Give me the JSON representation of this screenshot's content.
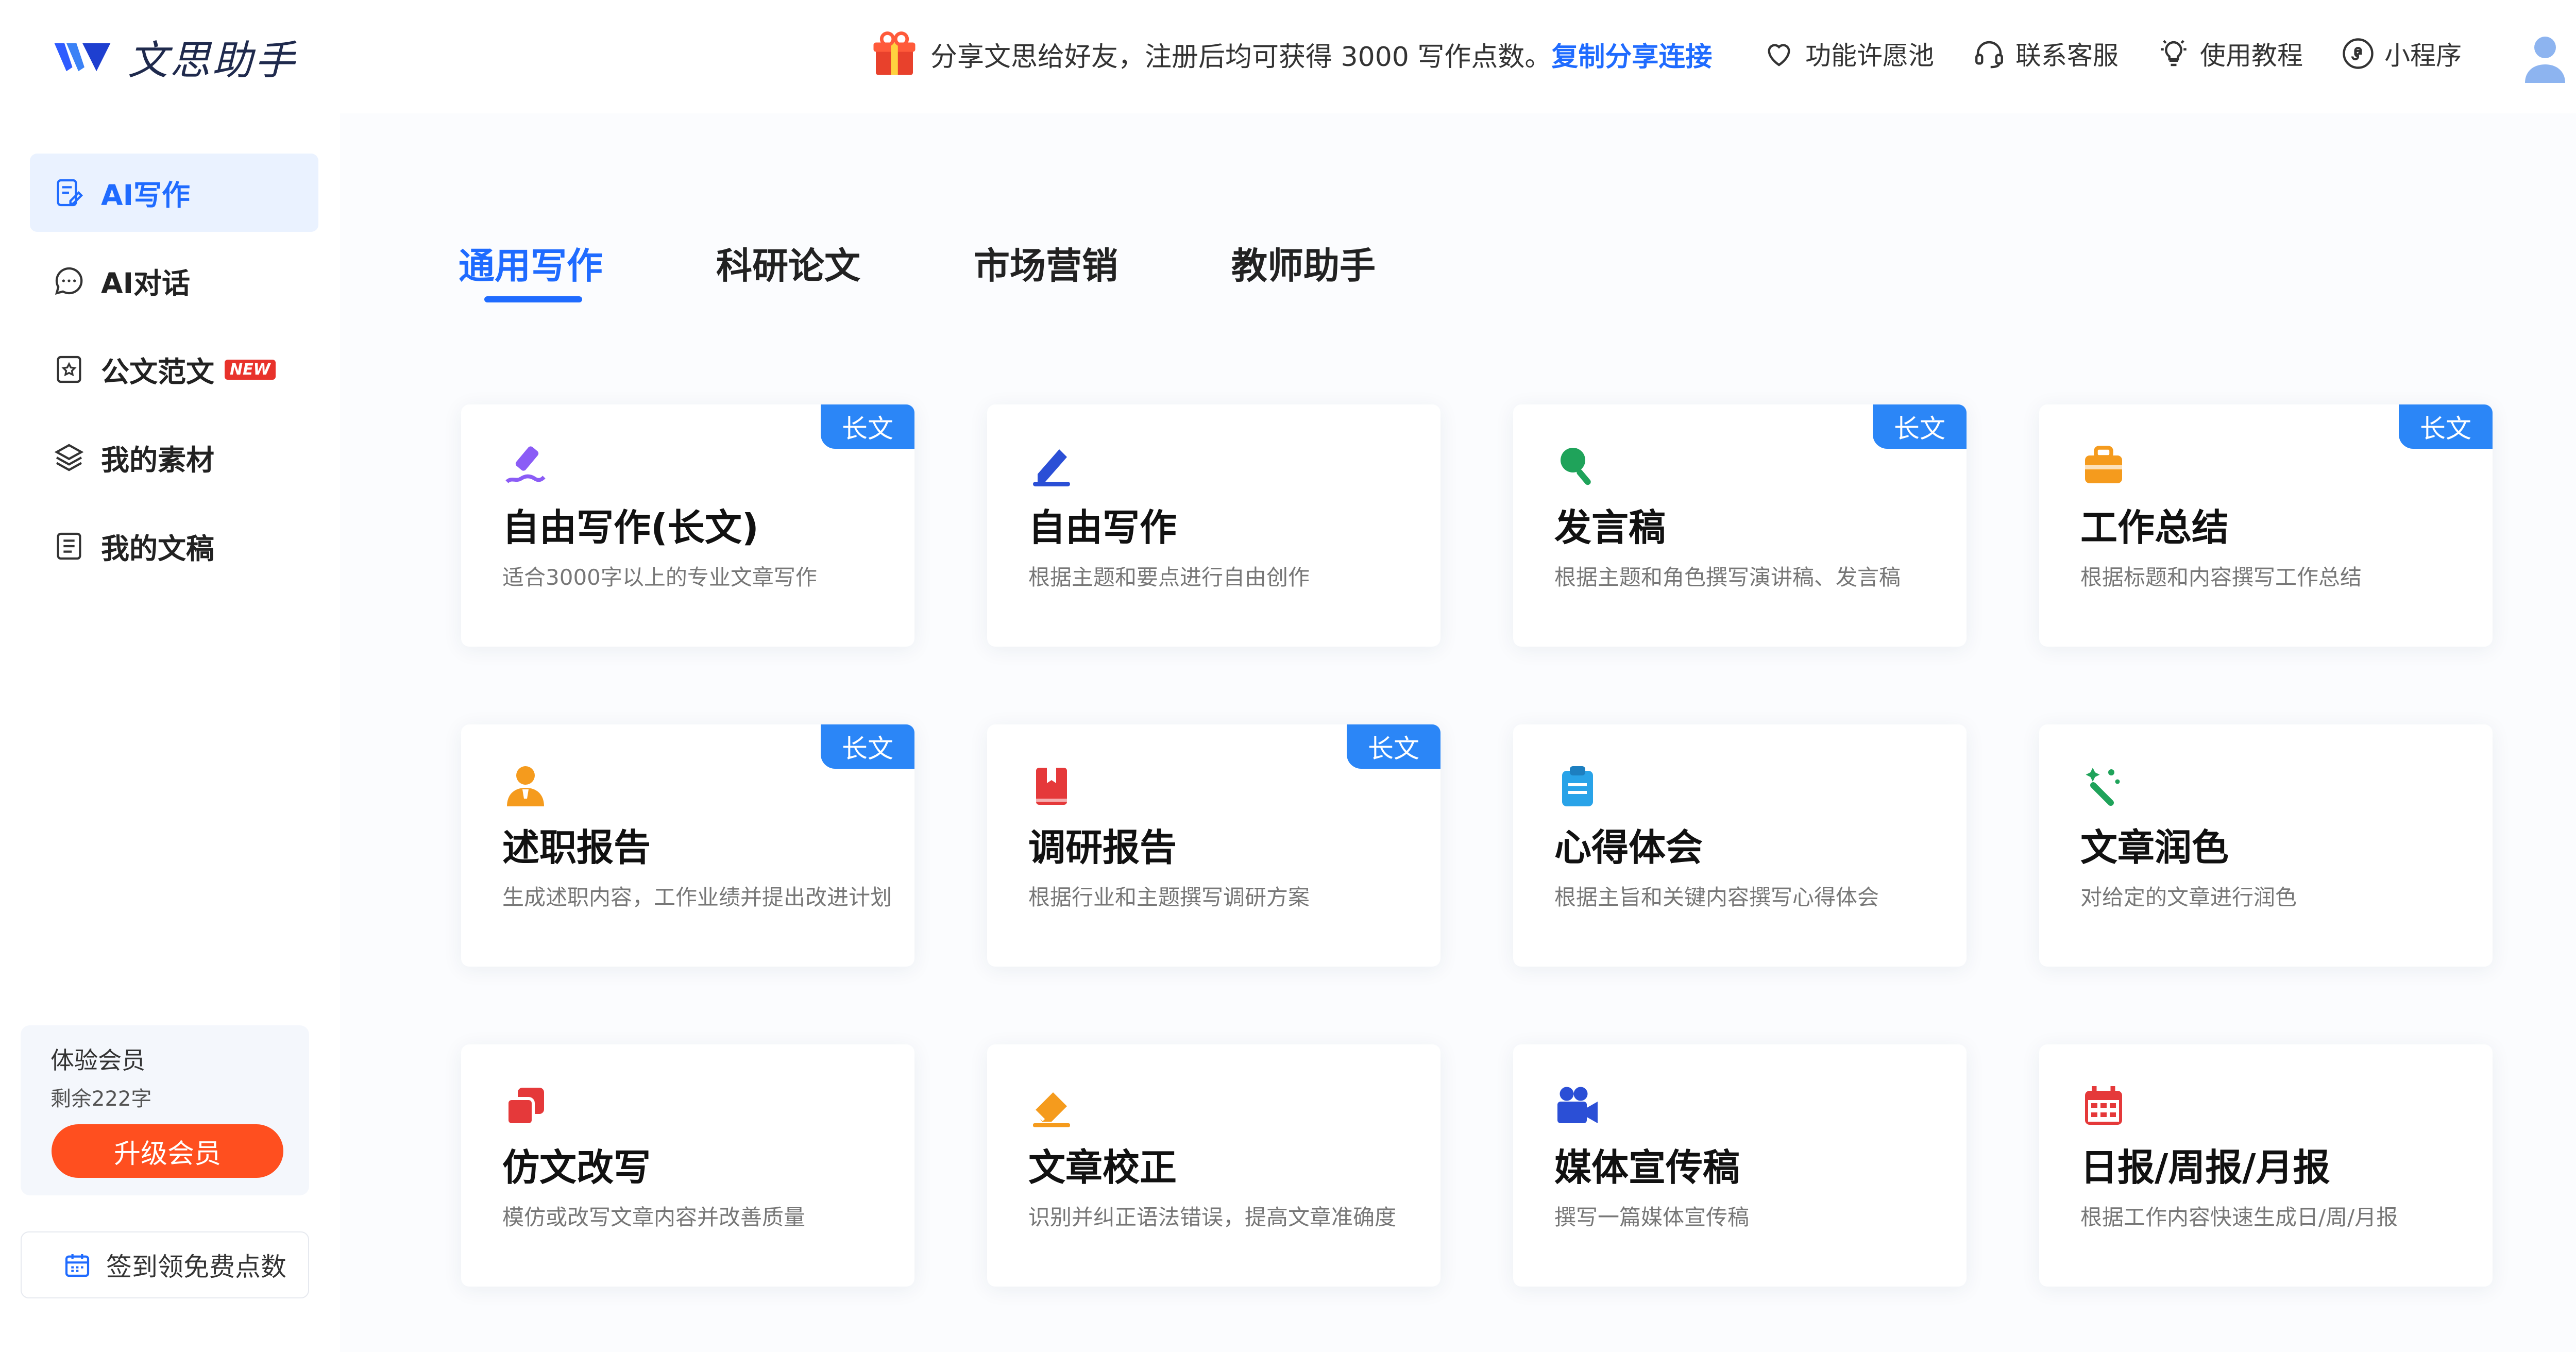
{
  "header": {
    "logo_text": "文思助手",
    "share_text": "分享文思给好友，注册后均可获得 3000 写作点数。",
    "share_link": "复制分享连接",
    "nav": [
      {
        "label": "功能许愿池",
        "icon": "heart-icon"
      },
      {
        "label": "联系客服",
        "icon": "headset-icon"
      },
      {
        "label": "使用教程",
        "icon": "bulb-icon"
      },
      {
        "label": "小程序",
        "icon": "miniprogram-icon"
      }
    ]
  },
  "sidebar": {
    "items": [
      {
        "label": "AI写作",
        "icon": "write-icon"
      },
      {
        "label": "AI对话",
        "icon": "chat-icon"
      },
      {
        "label": "公文范文",
        "icon": "doc-star-icon",
        "badge": "NEW"
      },
      {
        "label": "我的素材",
        "icon": "layers-icon"
      },
      {
        "label": "我的文稿",
        "icon": "document-icon"
      }
    ],
    "member": {
      "title": "体验会员",
      "remaining": "剩余222字",
      "upgrade": "升级会员"
    },
    "signin": "签到领免费点数"
  },
  "tabs": [
    "通用写作",
    "科研论文",
    "市场营销",
    "教师助手"
  ],
  "cards": [
    {
      "title": "自由写作(长文)",
      "desc": "适合3000字以上的专业文章写作",
      "tag": "长文",
      "icon": "pen-purple-icon"
    },
    {
      "title": "自由写作",
      "desc": "根据主题和要点进行自由创作",
      "tag": "",
      "icon": "pen-blue-icon"
    },
    {
      "title": "发言稿",
      "desc": "根据主题和角色撰写演讲稿、发言稿",
      "tag": "长文",
      "icon": "microphone-icon"
    },
    {
      "title": "工作总结",
      "desc": "根据标题和内容撰写工作总结",
      "tag": "长文",
      "icon": "briefcase-icon"
    },
    {
      "title": "述职报告",
      "desc": "生成述职内容，工作业绩并提出改进计划",
      "tag": "长文",
      "icon": "person-badge-icon"
    },
    {
      "title": "调研报告",
      "desc": "根据行业和主题撰写调研方案",
      "tag": "长文",
      "icon": "book-icon"
    },
    {
      "title": "心得体会",
      "desc": "根据主旨和关键内容撰写心得体会",
      "tag": "",
      "icon": "clipboard-icon"
    },
    {
      "title": "文章润色",
      "desc": "对给定的文章进行润色",
      "tag": "",
      "icon": "magic-wand-icon"
    },
    {
      "title": "仿文改写",
      "desc": "模仿或改写文章内容并改善质量",
      "tag": "",
      "icon": "copy-icon"
    },
    {
      "title": "文章校正",
      "desc": "识别并纠正语法错误，提高文章准确度",
      "tag": "",
      "icon": "eraser-icon"
    },
    {
      "title": "媒体宣传稿",
      "desc": "撰写一篇媒体宣传稿",
      "tag": "",
      "icon": "video-camera-icon"
    },
    {
      "title": "日报/周报/月报",
      "desc": "根据工作内容快速生成日/周/月报",
      "tag": "",
      "icon": "calendar-icon"
    }
  ],
  "colors": {
    "accent": "#1f6bff",
    "tag": "#2b86f7",
    "upgrade": "#ff4f1f"
  }
}
